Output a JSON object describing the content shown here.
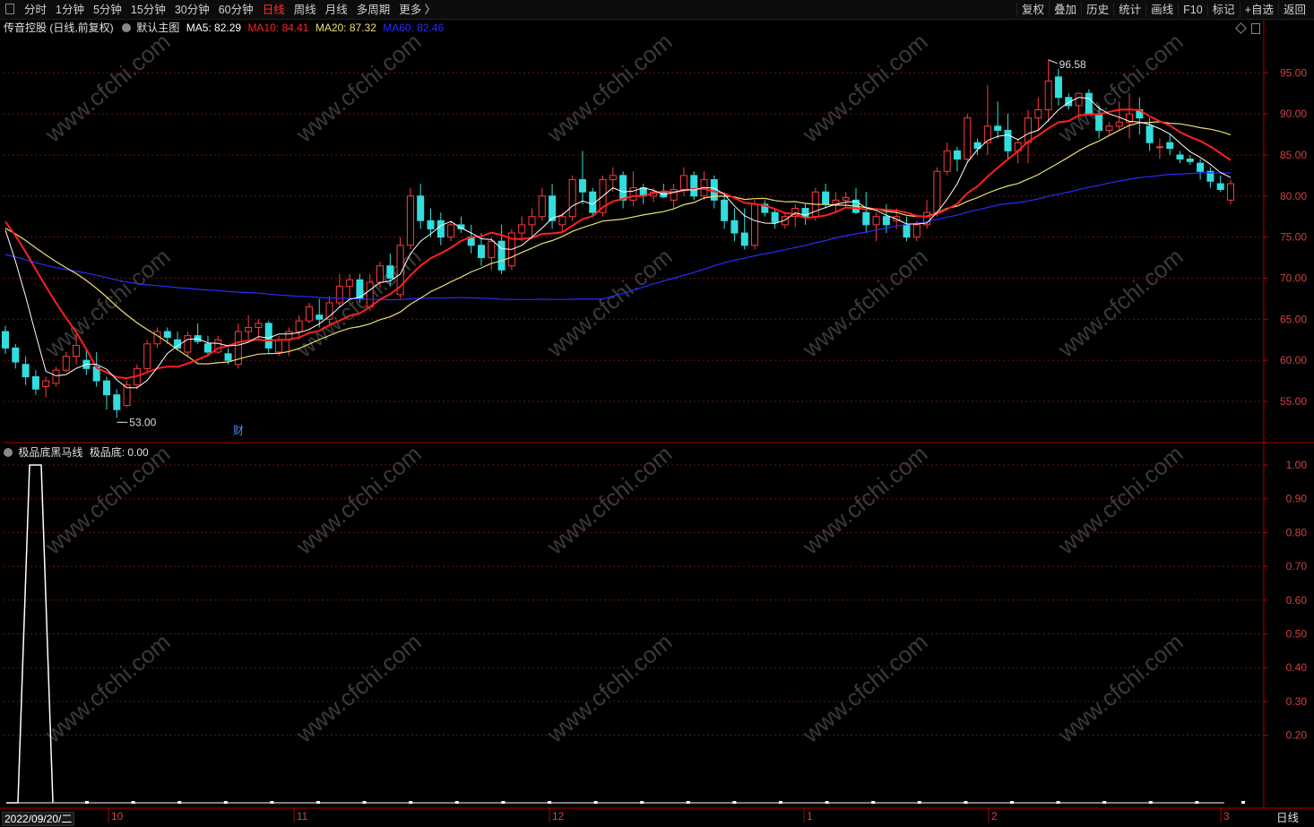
{
  "toolbar": {
    "left": [
      {
        "label": "分时",
        "active": false
      },
      {
        "label": "1分钟",
        "active": false
      },
      {
        "label": "5分钟",
        "active": false
      },
      {
        "label": "15分钟",
        "active": false
      },
      {
        "label": "30分钟",
        "active": false
      },
      {
        "label": "60分钟",
        "active": false
      },
      {
        "label": "日线",
        "active": true
      },
      {
        "label": "周线",
        "active": false
      },
      {
        "label": "月线",
        "active": false
      },
      {
        "label": "多周期",
        "active": false
      },
      {
        "label": "更多 〉",
        "active": false
      }
    ],
    "right": [
      "复权",
      "叠加",
      "历史",
      "统计",
      "画线",
      "F10",
      "标记",
      "+自选",
      "返回"
    ]
  },
  "main_legend": {
    "title": "传音控股 (日线,前复权)",
    "template": "默认主图",
    "ma5": "MA5: 82.29",
    "ma10": "MA10: 84.41",
    "ma20": "MA20: 87.32",
    "ma60": "MA60: 82.46"
  },
  "sub_legend": {
    "title": "极品底黑马线",
    "value": "极品底: 0.00"
  },
  "watermark": "www.cfchi.com",
  "colors": {
    "up": "#ff3b3b",
    "down": "#33dddd",
    "ma5": "#ffffff",
    "ma10": "#ff2020",
    "ma20": "#e8e070",
    "ma60": "#2b2bff",
    "grid": "#6b1515",
    "axis": "#b00000",
    "axis_text": "#d04040"
  },
  "markers": {
    "high_label": "96.58",
    "low_label": "53.00",
    "fin_label": "财"
  },
  "bottom": {
    "date": "2022/09/20/二",
    "period": "日线",
    "months": [
      "10",
      "11",
      "12",
      "1",
      "2",
      "3"
    ]
  },
  "chart_data": [
    {
      "type": "candlestick",
      "title": "传音控股 (日线,前复权)",
      "y_ticks": [
        55,
        60,
        65,
        70,
        75,
        80,
        85,
        90,
        95
      ],
      "y_tick_labels": [
        "55.00",
        "60.00",
        "65.00",
        "70.00",
        "75.00",
        "80.00",
        "85.00",
        "90.00",
        "95.00"
      ],
      "ylim": [
        50.2,
        99.5
      ],
      "ohlc": [
        [
          63.5,
          64.2,
          60.8,
          61.5
        ],
        [
          61.5,
          62.0,
          59.0,
          59.8
        ],
        [
          59.5,
          60.5,
          57.0,
          58.0
        ],
        [
          58.0,
          58.8,
          55.8,
          56.5
        ],
        [
          56.8,
          58.0,
          55.5,
          57.5
        ],
        [
          57.2,
          59.2,
          56.8,
          58.8
        ],
        [
          58.8,
          61.0,
          58.5,
          60.5
        ],
        [
          60.5,
          63.5,
          59.5,
          61.8
        ],
        [
          60.0,
          61.5,
          58.2,
          59.0
        ],
        [
          59.2,
          61.0,
          56.8,
          57.5
        ],
        [
          57.5,
          58.0,
          54.0,
          55.8
        ],
        [
          55.8,
          56.5,
          53.0,
          54.0
        ],
        [
          54.5,
          57.5,
          54.3,
          57.0
        ],
        [
          57.0,
          59.5,
          56.5,
          59.0
        ],
        [
          59.0,
          62.5,
          58.5,
          62.0
        ],
        [
          62.0,
          64.0,
          61.5,
          63.5
        ],
        [
          63.5,
          64.0,
          62.0,
          62.8
        ],
        [
          62.5,
          63.5,
          61.2,
          61.5
        ],
        [
          61.0,
          63.5,
          60.5,
          63.0
        ],
        [
          63.0,
          64.5,
          62.0,
          62.3
        ],
        [
          62.0,
          63.0,
          60.5,
          61.0
        ],
        [
          61.0,
          63.0,
          60.8,
          62.5
        ],
        [
          60.8,
          61.5,
          59.5,
          60.0
        ],
        [
          59.5,
          64.5,
          59.0,
          63.5
        ],
        [
          63.5,
          65.5,
          62.5,
          64.0
        ],
        [
          64.0,
          65.0,
          62.5,
          64.5
        ],
        [
          64.5,
          64.8,
          60.8,
          61.5
        ],
        [
          61.0,
          63.0,
          60.5,
          62.5
        ],
        [
          62.5,
          64.0,
          60.5,
          63.5
        ],
        [
          63.5,
          65.5,
          62.5,
          64.8
        ],
        [
          64.8,
          67.0,
          64.5,
          66.5
        ],
        [
          65.5,
          67.5,
          64.0,
          65.0
        ],
        [
          65.0,
          67.8,
          64.5,
          67.0
        ],
        [
          67.0,
          70.5,
          66.5,
          69.0
        ],
        [
          69.0,
          70.5,
          67.5,
          69.8
        ],
        [
          69.8,
          70.5,
          67.0,
          67.5
        ],
        [
          66.5,
          70.5,
          66.0,
          69.5
        ],
        [
          69.5,
          72.0,
          68.8,
          71.5
        ],
        [
          71.5,
          73.0,
          69.0,
          70.0
        ],
        [
          68.0,
          75.0,
          67.5,
          74.0
        ],
        [
          74.0,
          81.0,
          73.5,
          80.0
        ],
        [
          80.0,
          81.5,
          76.0,
          77.0
        ],
        [
          77.0,
          78.5,
          75.0,
          76.0
        ],
        [
          77.0,
          78.0,
          74.0,
          75.0
        ],
        [
          75.0,
          77.0,
          74.5,
          76.5
        ],
        [
          76.5,
          77.5,
          75.5,
          76.0
        ],
        [
          75.0,
          76.5,
          73.0,
          74.0
        ],
        [
          74.0,
          75.5,
          71.5,
          72.5
        ],
        [
          72.5,
          75.0,
          71.0,
          74.5
        ],
        [
          74.5,
          76.5,
          70.5,
          71.0
        ],
        [
          71.5,
          76.0,
          71.0,
          75.5
        ],
        [
          75.5,
          77.5,
          74.5,
          76.5
        ],
        [
          76.5,
          78.5,
          75.0,
          77.5
        ],
        [
          77.5,
          81.0,
          77.0,
          80.0
        ],
        [
          80.0,
          81.5,
          76.0,
          77.0
        ],
        [
          76.5,
          78.0,
          75.5,
          77.5
        ],
        [
          77.5,
          82.5,
          77.0,
          82.0
        ],
        [
          82.0,
          85.5,
          79.0,
          80.5
        ],
        [
          80.5,
          81.0,
          77.5,
          78.0
        ],
        [
          78.0,
          82.5,
          77.5,
          82.0
        ],
        [
          82.0,
          83.5,
          80.5,
          82.5
        ],
        [
          82.5,
          83.0,
          78.5,
          79.5
        ],
        [
          79.5,
          83.0,
          78.8,
          81.0
        ],
        [
          81.0,
          81.5,
          79.0,
          80.0
        ],
        [
          80.0,
          81.0,
          79.3,
          80.5
        ],
        [
          80.5,
          81.5,
          79.8,
          79.9
        ],
        [
          79.5,
          81.5,
          78.5,
          80.8
        ],
        [
          80.8,
          83.5,
          80.0,
          82.5
        ],
        [
          82.5,
          83.0,
          79.5,
          80.0
        ],
        [
          80.0,
          83.0,
          79.5,
          82.0
        ],
        [
          82.0,
          82.5,
          78.5,
          79.5
        ],
        [
          79.5,
          80.0,
          76.0,
          77.0
        ],
        [
          77.0,
          78.5,
          74.5,
          75.5
        ],
        [
          75.5,
          78.5,
          73.5,
          74.0
        ],
        [
          74.0,
          79.5,
          73.5,
          79.0
        ],
        [
          79.0,
          79.5,
          77.5,
          78.0
        ],
        [
          78.0,
          78.5,
          76.0,
          76.8
        ],
        [
          76.5,
          78.0,
          76.0,
          77.5
        ],
        [
          77.5,
          79.0,
          76.2,
          78.5
        ],
        [
          78.5,
          79.0,
          76.5,
          77.5
        ],
        [
          77.5,
          81.0,
          77.0,
          80.5
        ],
        [
          80.5,
          81.5,
          78.5,
          79.0
        ],
        [
          79.0,
          80.5,
          78.0,
          79.5
        ],
        [
          79.5,
          80.5,
          78.5,
          79.8
        ],
        [
          79.5,
          81.0,
          77.8,
          78.0
        ],
        [
          78.0,
          80.5,
          75.5,
          76.5
        ],
        [
          76.5,
          78.0,
          74.5,
          77.5
        ],
        [
          77.5,
          79.0,
          75.5,
          76.5
        ],
        [
          77.0,
          78.5,
          76.0,
          77.5
        ],
        [
          76.5,
          77.5,
          74.5,
          75.0
        ],
        [
          75.0,
          77.0,
          74.5,
          76.5
        ],
        [
          76.5,
          79.5,
          76.0,
          78.0
        ],
        [
          78.0,
          83.5,
          77.5,
          83.0
        ],
        [
          83.0,
          86.5,
          82.5,
          85.5
        ],
        [
          85.5,
          86.0,
          83.0,
          84.5
        ],
        [
          84.5,
          90.0,
          84.0,
          89.5
        ],
        [
          86.5,
          87.0,
          85.0,
          85.8
        ],
        [
          86.5,
          93.5,
          85.0,
          88.5
        ],
        [
          88.5,
          91.5,
          87.0,
          88.0
        ],
        [
          88.0,
          90.0,
          84.5,
          85.5
        ],
        [
          85.5,
          87.0,
          84.0,
          86.5
        ],
        [
          86.5,
          90.5,
          84.0,
          89.5
        ],
        [
          89.5,
          92.0,
          88.0,
          90.5
        ],
        [
          90.5,
          96.58,
          89.0,
          94.0
        ],
        [
          94.5,
          95.5,
          91.0,
          92.0
        ],
        [
          92.0,
          92.5,
          90.5,
          91.0
        ],
        [
          91.0,
          92.5,
          89.5,
          92.5
        ],
        [
          92.5,
          93.0,
          90.0,
          90.0
        ],
        [
          90.0,
          91.0,
          87.0,
          88.0
        ],
        [
          88.0,
          89.0,
          87.5,
          88.5
        ],
        [
          88.5,
          91.5,
          88.0,
          89.0
        ],
        [
          89.0,
          92.5,
          87.0,
          90.0
        ],
        [
          90.5,
          92.0,
          87.5,
          89.5
        ],
        [
          88.5,
          89.5,
          85.5,
          86.5
        ],
        [
          86.0,
          87.0,
          84.5,
          86.0
        ],
        [
          86.5,
          87.5,
          85.0,
          85.8
        ],
        [
          85.0,
          85.5,
          84.0,
          84.5
        ],
        [
          84.5,
          85.0,
          83.8,
          84.2
        ],
        [
          84.0,
          84.5,
          82.0,
          83.0
        ],
        [
          83.0,
          83.5,
          81.0,
          81.8
        ],
        [
          81.5,
          82.5,
          80.5,
          80.8
        ],
        [
          79.5,
          82.0,
          79.0,
          81.5
        ]
      ]
    },
    {
      "type": "line",
      "title": "极品底黑马线",
      "series": [
        {
          "name": "极品底",
          "values": [
            0,
            0,
            1,
            1,
            1,
            0,
            0,
            0,
            0,
            0,
            0,
            0,
            0,
            0,
            0,
            0,
            0,
            0,
            0,
            0,
            0,
            0,
            0,
            0,
            0,
            0,
            0,
            0,
            0,
            0,
            0,
            0,
            0,
            0,
            0,
            0,
            0,
            0,
            0,
            0,
            0,
            0,
            0,
            0,
            0,
            0,
            0,
            0,
            0,
            0,
            0,
            0,
            0,
            0,
            0,
            0,
            0,
            0,
            0,
            0,
            0,
            0,
            0,
            0,
            0,
            0,
            0,
            0,
            0,
            0,
            0,
            0,
            0,
            0,
            0,
            0,
            0,
            0,
            0,
            0,
            0,
            0,
            0,
            0,
            0,
            0,
            0,
            0,
            0,
            0,
            0,
            0,
            0,
            0,
            0,
            0,
            0,
            0,
            0,
            0,
            0,
            0,
            0,
            0,
            0,
            0,
            0,
            0,
            0,
            0,
            0,
            0,
            0,
            0,
            0,
            0,
            0,
            0,
            0,
            0,
            0,
            0,
            0,
            0,
            0
          ]
        }
      ],
      "y_ticks": [
        0.2,
        0.3,
        0.4,
        0.5,
        0.6,
        0.7,
        0.8,
        0.9,
        1.0
      ],
      "y_tick_labels": [
        "0.20",
        "0.30",
        "0.40",
        "0.50",
        "0.60",
        "0.70",
        "0.80",
        "0.90",
        "1.00"
      ],
      "ylim": [
        0,
        1.0
      ]
    }
  ]
}
